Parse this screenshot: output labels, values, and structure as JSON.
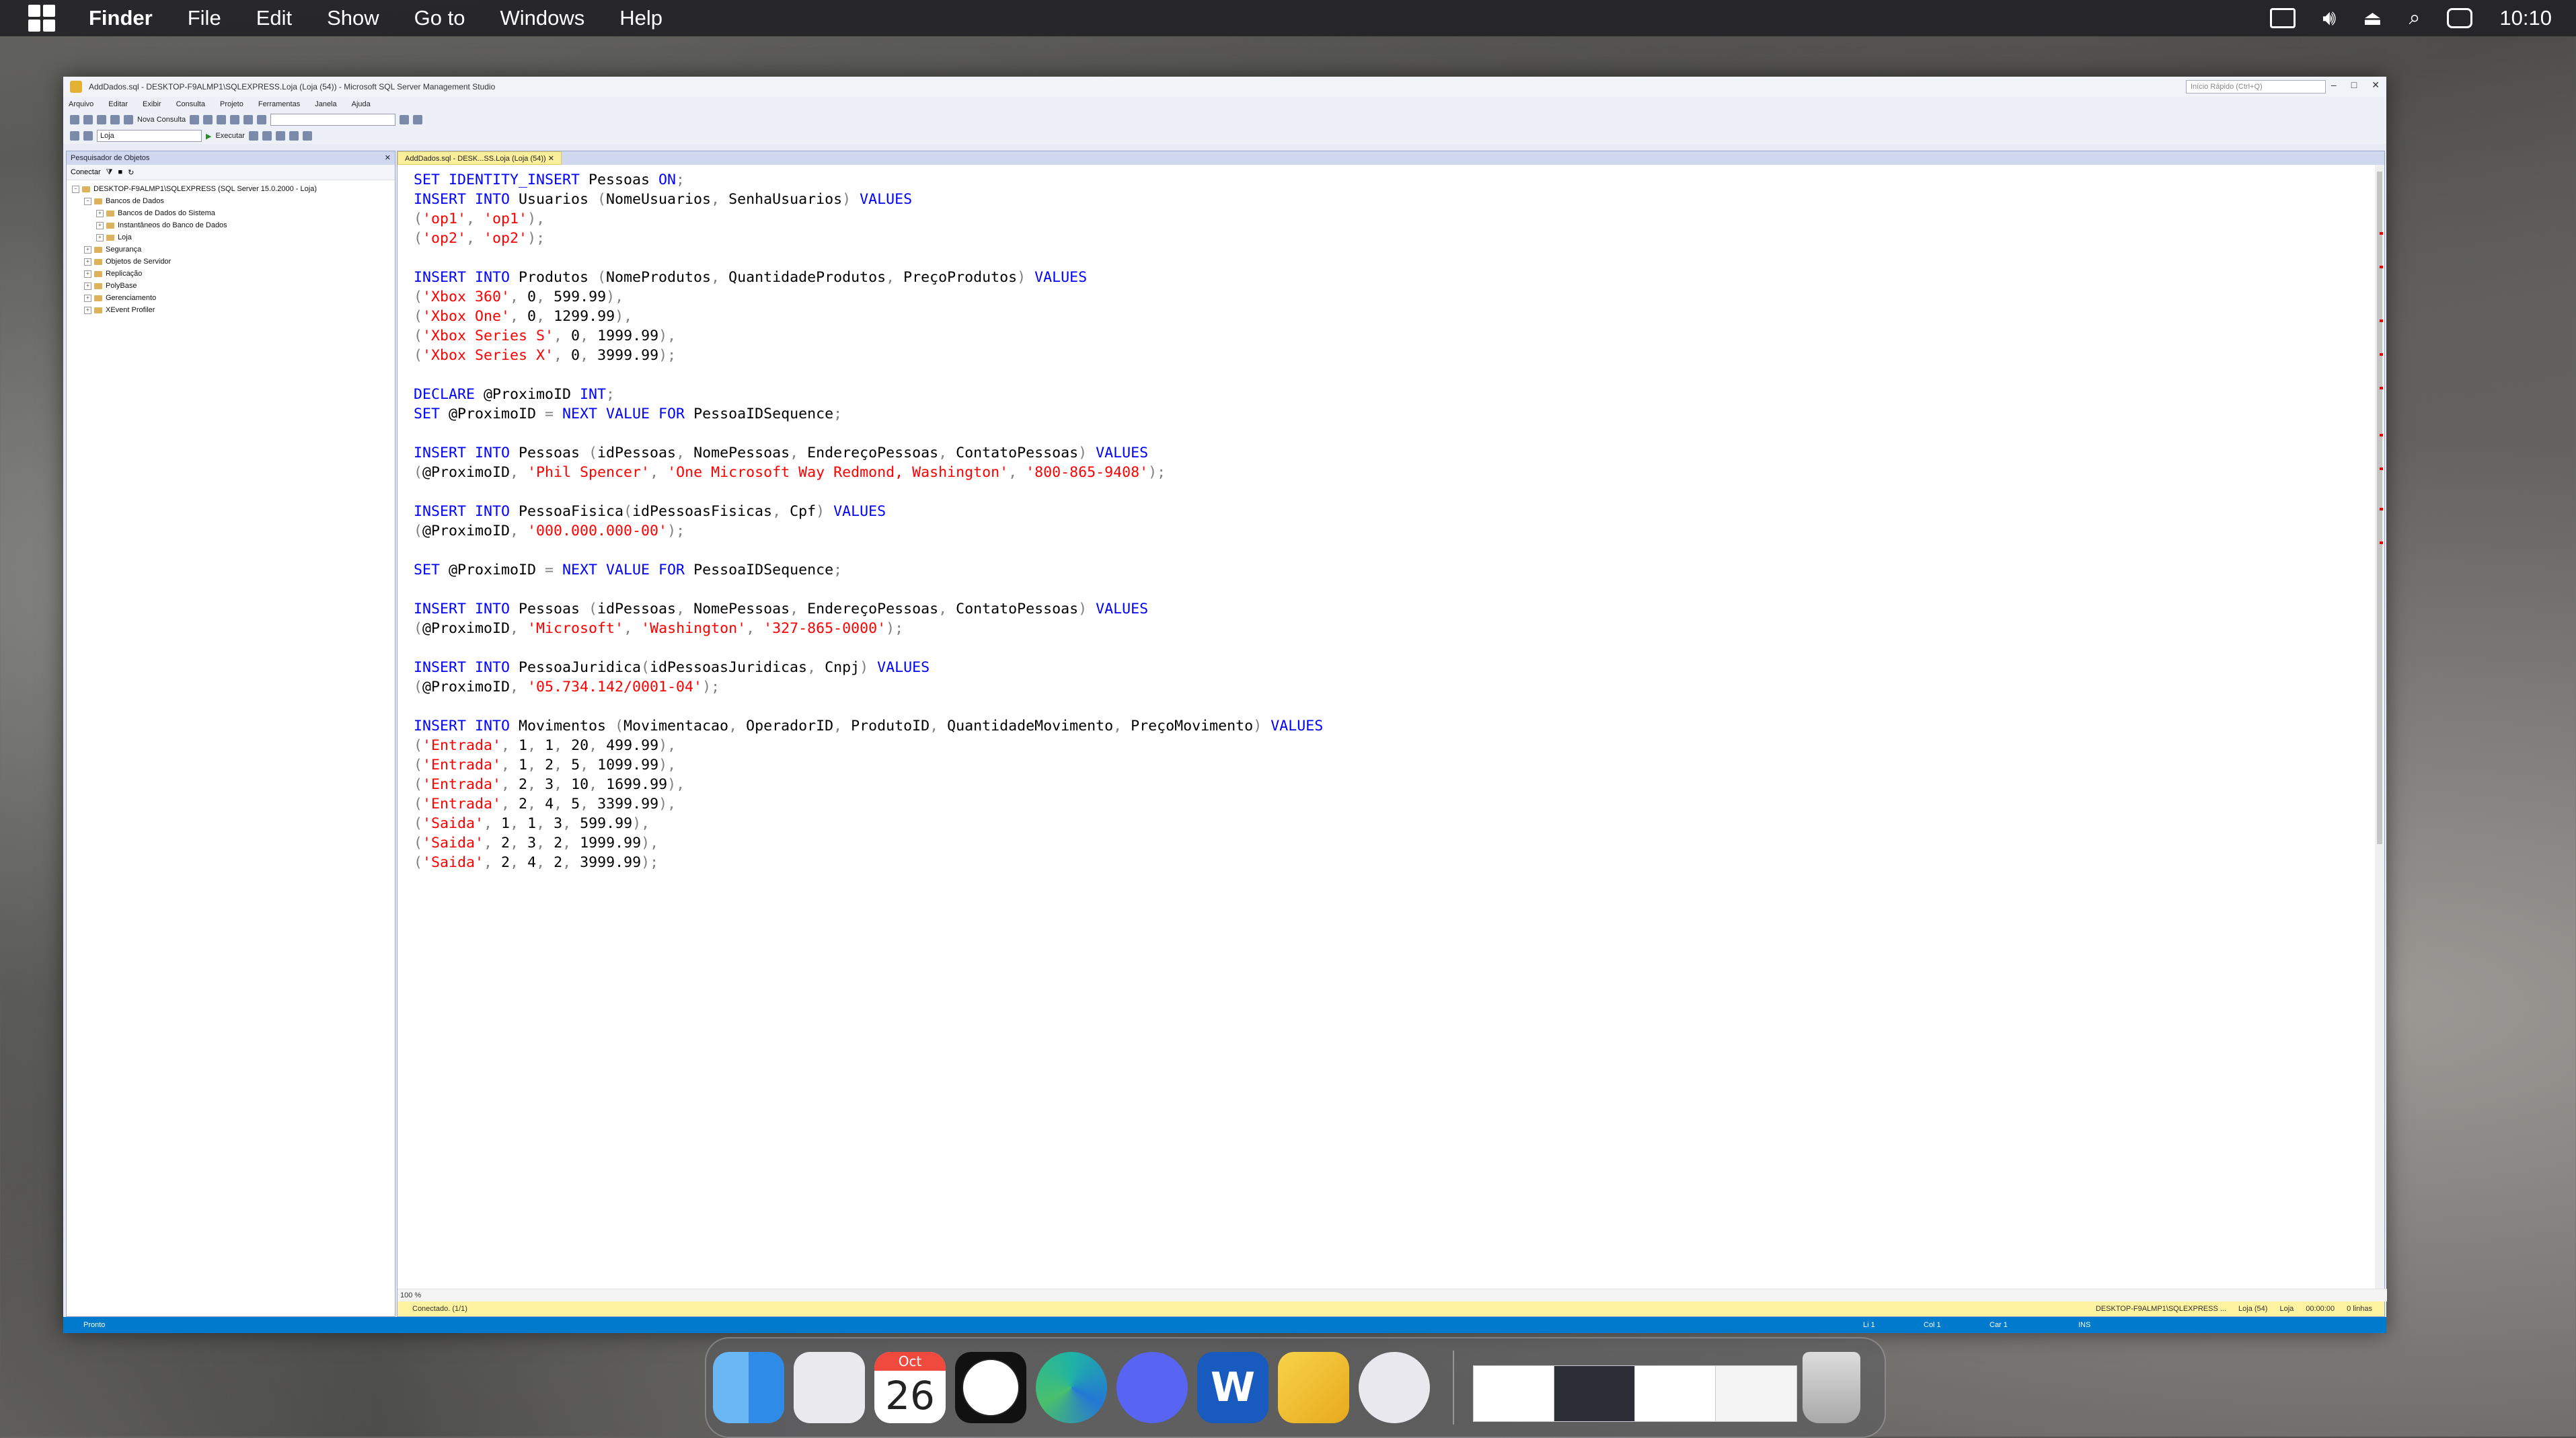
{
  "menubar": {
    "app": "Finder",
    "items": [
      "File",
      "Edit",
      "Show",
      "Go to",
      "Windows",
      "Help"
    ],
    "clock": "10:10"
  },
  "ssms": {
    "title": "AddDados.sql - DESKTOP-F9ALMP1\\SQLEXPRESS.Loja (Loja (54)) - Microsoft SQL Server Management Studio",
    "quick_launch": "Início Rápido (Ctrl+Q)",
    "menus": [
      "Arquivo",
      "Editar",
      "Exibir",
      "Consulta",
      "Projeto",
      "Ferramentas",
      "Janela",
      "Ajuda"
    ],
    "toolbar": {
      "new_query": "Nova Consulta",
      "database": "Loja",
      "execute": "Executar"
    },
    "object_explorer": {
      "title": "Pesquisador de Objetos",
      "connect": "Conectar",
      "tree": [
        {
          "label": "DESKTOP-F9ALMP1\\SQLEXPRESS (SQL Server 15.0.2000 - Loja)",
          "level": 0
        },
        {
          "label": "Bancos de Dados",
          "level": 1
        },
        {
          "label": "Bancos de Dados do Sistema",
          "level": 2
        },
        {
          "label": "Instantâneos do Banco de Dados",
          "level": 2
        },
        {
          "label": "Loja",
          "level": 2
        },
        {
          "label": "Segurança",
          "level": 1
        },
        {
          "label": "Objetos de Servidor",
          "level": 1
        },
        {
          "label": "Replicação",
          "level": 1
        },
        {
          "label": "PolyBase",
          "level": 1
        },
        {
          "label": "Gerenciamento",
          "level": 1
        },
        {
          "label": "XEvent Profiler",
          "level": 1
        }
      ]
    },
    "editor": {
      "tab": "AddDados.sql - DESK...SS.Loja (Loja (54))",
      "zoom": "100 %",
      "connected": "Conectado. (1/1)",
      "conn_server": "DESKTOP-F9ALMP1\\SQLEXPRESS ...",
      "conn_db": "Loja (54)",
      "conn_user": "Loja",
      "conn_time": "00:00:00",
      "conn_rows": "0 linhas"
    },
    "status": {
      "ready": "Pronto",
      "ln": "Li 1",
      "col": "Col 1",
      "car": "Car 1",
      "ins": "INS"
    }
  },
  "code": [
    [
      [
        "kw",
        "SET IDENTITY_INSERT "
      ],
      [
        "t",
        "Pessoas "
      ],
      [
        "kw",
        "ON"
      ],
      [
        "gr",
        ";"
      ]
    ],
    [
      [
        "kw",
        "INSERT INTO "
      ],
      [
        "t",
        "Usuarios "
      ],
      [
        "gr",
        "("
      ],
      [
        "t",
        "NomeUsuarios"
      ],
      [
        "gr",
        ", "
      ],
      [
        "t",
        "SenhaUsuarios"
      ],
      [
        "gr",
        ") "
      ],
      [
        "kw",
        "VALUES"
      ]
    ],
    [
      [
        "gr",
        "("
      ],
      [
        "str",
        "'op1'"
      ],
      [
        "gr",
        ", "
      ],
      [
        "str",
        "'op1'"
      ],
      [
        "gr",
        "),"
      ]
    ],
    [
      [
        "gr",
        "("
      ],
      [
        "str",
        "'op2'"
      ],
      [
        "gr",
        ", "
      ],
      [
        "str",
        "'op2'"
      ],
      [
        "gr",
        ");"
      ]
    ],
    [],
    [
      [
        "kw",
        "INSERT INTO "
      ],
      [
        "t",
        "Produtos "
      ],
      [
        "gr",
        "("
      ],
      [
        "t",
        "NomeProdutos"
      ],
      [
        "gr",
        ", "
      ],
      [
        "t",
        "QuantidadeProdutos"
      ],
      [
        "gr",
        ", "
      ],
      [
        "t",
        "PreçoProdutos"
      ],
      [
        "gr",
        ") "
      ],
      [
        "kw",
        "VALUES"
      ]
    ],
    [
      [
        "gr",
        "("
      ],
      [
        "str",
        "'Xbox 360'"
      ],
      [
        "gr",
        ", "
      ],
      [
        "t",
        "0"
      ],
      [
        "gr",
        ", "
      ],
      [
        "t",
        "599.99"
      ],
      [
        "gr",
        "),"
      ]
    ],
    [
      [
        "gr",
        "("
      ],
      [
        "str",
        "'Xbox One'"
      ],
      [
        "gr",
        ", "
      ],
      [
        "t",
        "0"
      ],
      [
        "gr",
        ", "
      ],
      [
        "t",
        "1299.99"
      ],
      [
        "gr",
        "),"
      ]
    ],
    [
      [
        "gr",
        "("
      ],
      [
        "str",
        "'Xbox Series S'"
      ],
      [
        "gr",
        ", "
      ],
      [
        "t",
        "0"
      ],
      [
        "gr",
        ", "
      ],
      [
        "t",
        "1999.99"
      ],
      [
        "gr",
        "),"
      ]
    ],
    [
      [
        "gr",
        "("
      ],
      [
        "str",
        "'Xbox Series X'"
      ],
      [
        "gr",
        ", "
      ],
      [
        "t",
        "0"
      ],
      [
        "gr",
        ", "
      ],
      [
        "t",
        "3999.99"
      ],
      [
        "gr",
        ");"
      ]
    ],
    [],
    [
      [
        "kw",
        "DECLARE "
      ],
      [
        "t",
        "@ProximoID "
      ],
      [
        "kw",
        "INT"
      ],
      [
        "gr",
        ";"
      ]
    ],
    [
      [
        "kw",
        "SET "
      ],
      [
        "t",
        "@ProximoID "
      ],
      [
        "gr",
        "= "
      ],
      [
        "kw",
        "NEXT VALUE FOR "
      ],
      [
        "t",
        "PessoaIDSequence"
      ],
      [
        "gr",
        ";"
      ]
    ],
    [],
    [
      [
        "kw",
        "INSERT INTO "
      ],
      [
        "t",
        "Pessoas "
      ],
      [
        "gr",
        "("
      ],
      [
        "t",
        "idPessoas"
      ],
      [
        "gr",
        ", "
      ],
      [
        "t",
        "NomePessoas"
      ],
      [
        "gr",
        ", "
      ],
      [
        "t",
        "EndereçoPessoas"
      ],
      [
        "gr",
        ", "
      ],
      [
        "t",
        "ContatoPessoas"
      ],
      [
        "gr",
        ") "
      ],
      [
        "kw",
        "VALUES"
      ]
    ],
    [
      [
        "gr",
        "("
      ],
      [
        "t",
        "@ProximoID"
      ],
      [
        "gr",
        ", "
      ],
      [
        "str",
        "'Phil Spencer'"
      ],
      [
        "gr",
        ", "
      ],
      [
        "str",
        "'One Microsoft Way Redmond, Washington'"
      ],
      [
        "gr",
        ", "
      ],
      [
        "str",
        "'800-865-9408'"
      ],
      [
        "gr",
        ");"
      ]
    ],
    [],
    [
      [
        "kw",
        "INSERT INTO "
      ],
      [
        "t",
        "PessoaFisica"
      ],
      [
        "gr",
        "("
      ],
      [
        "t",
        "idPessoasFisicas"
      ],
      [
        "gr",
        ", "
      ],
      [
        "t",
        "Cpf"
      ],
      [
        "gr",
        ") "
      ],
      [
        "kw",
        "VALUES"
      ]
    ],
    [
      [
        "gr",
        "("
      ],
      [
        "t",
        "@ProximoID"
      ],
      [
        "gr",
        ", "
      ],
      [
        "str",
        "'000.000.000-00'"
      ],
      [
        "gr",
        ");"
      ]
    ],
    [],
    [
      [
        "kw",
        "SET "
      ],
      [
        "t",
        "@ProximoID "
      ],
      [
        "gr",
        "= "
      ],
      [
        "kw",
        "NEXT VALUE FOR "
      ],
      [
        "t",
        "PessoaIDSequence"
      ],
      [
        "gr",
        ";"
      ]
    ],
    [],
    [
      [
        "kw",
        "INSERT INTO "
      ],
      [
        "t",
        "Pessoas "
      ],
      [
        "gr",
        "("
      ],
      [
        "t",
        "idPessoas"
      ],
      [
        "gr",
        ", "
      ],
      [
        "t",
        "NomePessoas"
      ],
      [
        "gr",
        ", "
      ],
      [
        "t",
        "EndereçoPessoas"
      ],
      [
        "gr",
        ", "
      ],
      [
        "t",
        "ContatoPessoas"
      ],
      [
        "gr",
        ") "
      ],
      [
        "kw",
        "VALUES"
      ]
    ],
    [
      [
        "gr",
        "("
      ],
      [
        "t",
        "@ProximoID"
      ],
      [
        "gr",
        ", "
      ],
      [
        "str",
        "'Microsoft'"
      ],
      [
        "gr",
        ", "
      ],
      [
        "str",
        "'Washington'"
      ],
      [
        "gr",
        ", "
      ],
      [
        "str",
        "'327-865-0000'"
      ],
      [
        "gr",
        ");"
      ]
    ],
    [],
    [
      [
        "kw",
        "INSERT INTO "
      ],
      [
        "t",
        "PessoaJuridica"
      ],
      [
        "gr",
        "("
      ],
      [
        "t",
        "idPessoasJuridicas"
      ],
      [
        "gr",
        ", "
      ],
      [
        "t",
        "Cnpj"
      ],
      [
        "gr",
        ") "
      ],
      [
        "kw",
        "VALUES"
      ]
    ],
    [
      [
        "gr",
        "("
      ],
      [
        "t",
        "@ProximoID"
      ],
      [
        "gr",
        ", "
      ],
      [
        "str",
        "'05.734.142/0001-04'"
      ],
      [
        "gr",
        ");"
      ]
    ],
    [],
    [
      [
        "kw",
        "INSERT INTO "
      ],
      [
        "t",
        "Movimentos "
      ],
      [
        "gr",
        "("
      ],
      [
        "t",
        "Movimentacao"
      ],
      [
        "gr",
        ", "
      ],
      [
        "t",
        "OperadorID"
      ],
      [
        "gr",
        ", "
      ],
      [
        "t",
        "ProdutoID"
      ],
      [
        "gr",
        ", "
      ],
      [
        "t",
        "QuantidadeMovimento"
      ],
      [
        "gr",
        ", "
      ],
      [
        "t",
        "PreçoMovimento"
      ],
      [
        "gr",
        ") "
      ],
      [
        "kw",
        "VALUES"
      ]
    ],
    [
      [
        "gr",
        "("
      ],
      [
        "str",
        "'Entrada'"
      ],
      [
        "gr",
        ", "
      ],
      [
        "t",
        "1"
      ],
      [
        "gr",
        ", "
      ],
      [
        "t",
        "1"
      ],
      [
        "gr",
        ", "
      ],
      [
        "t",
        "20"
      ],
      [
        "gr",
        ", "
      ],
      [
        "t",
        "499.99"
      ],
      [
        "gr",
        "),"
      ]
    ],
    [
      [
        "gr",
        "("
      ],
      [
        "str",
        "'Entrada'"
      ],
      [
        "gr",
        ", "
      ],
      [
        "t",
        "1"
      ],
      [
        "gr",
        ", "
      ],
      [
        "t",
        "2"
      ],
      [
        "gr",
        ", "
      ],
      [
        "t",
        "5"
      ],
      [
        "gr",
        ", "
      ],
      [
        "t",
        "1099.99"
      ],
      [
        "gr",
        "),"
      ]
    ],
    [
      [
        "gr",
        "("
      ],
      [
        "str",
        "'Entrada'"
      ],
      [
        "gr",
        ", "
      ],
      [
        "t",
        "2"
      ],
      [
        "gr",
        ", "
      ],
      [
        "t",
        "3"
      ],
      [
        "gr",
        ", "
      ],
      [
        "t",
        "10"
      ],
      [
        "gr",
        ", "
      ],
      [
        "t",
        "1699.99"
      ],
      [
        "gr",
        "),"
      ]
    ],
    [
      [
        "gr",
        "("
      ],
      [
        "str",
        "'Entrada'"
      ],
      [
        "gr",
        ", "
      ],
      [
        "t",
        "2"
      ],
      [
        "gr",
        ", "
      ],
      [
        "t",
        "4"
      ],
      [
        "gr",
        ", "
      ],
      [
        "t",
        "5"
      ],
      [
        "gr",
        ", "
      ],
      [
        "t",
        "3399.99"
      ],
      [
        "gr",
        "),"
      ]
    ],
    [
      [
        "gr",
        "("
      ],
      [
        "str",
        "'Saida'"
      ],
      [
        "gr",
        ", "
      ],
      [
        "t",
        "1"
      ],
      [
        "gr",
        ", "
      ],
      [
        "t",
        "1"
      ],
      [
        "gr",
        ", "
      ],
      [
        "t",
        "3"
      ],
      [
        "gr",
        ", "
      ],
      [
        "t",
        "599.99"
      ],
      [
        "gr",
        "),"
      ]
    ],
    [
      [
        "gr",
        "("
      ],
      [
        "str",
        "'Saida'"
      ],
      [
        "gr",
        ", "
      ],
      [
        "t",
        "2"
      ],
      [
        "gr",
        ", "
      ],
      [
        "t",
        "3"
      ],
      [
        "gr",
        ", "
      ],
      [
        "t",
        "2"
      ],
      [
        "gr",
        ", "
      ],
      [
        "t",
        "1999.99"
      ],
      [
        "gr",
        "),"
      ]
    ],
    [
      [
        "gr",
        "("
      ],
      [
        "str",
        "'Saida'"
      ],
      [
        "gr",
        ", "
      ],
      [
        "t",
        "2"
      ],
      [
        "gr",
        ", "
      ],
      [
        "t",
        "4"
      ],
      [
        "gr",
        ", "
      ],
      [
        "t",
        "2"
      ],
      [
        "gr",
        ", "
      ],
      [
        "t",
        "3999.99"
      ],
      [
        "gr",
        ");"
      ]
    ]
  ],
  "dock": {
    "calendar": {
      "month": "Oct",
      "day": "26"
    },
    "apps": [
      "finder-icon",
      "launchpad-icon",
      "calendar-icon",
      "clock-icon",
      "edge-icon",
      "discord-icon",
      "word-icon",
      "sql-server-icon",
      "snipping-tool-icon"
    ],
    "word_letter": "W"
  },
  "colors": {
    "keyword": "#0000ff",
    "string": "#ff0000",
    "punct": "#808080",
    "statusbar": "#007acc",
    "tab": "#fcef9c"
  }
}
